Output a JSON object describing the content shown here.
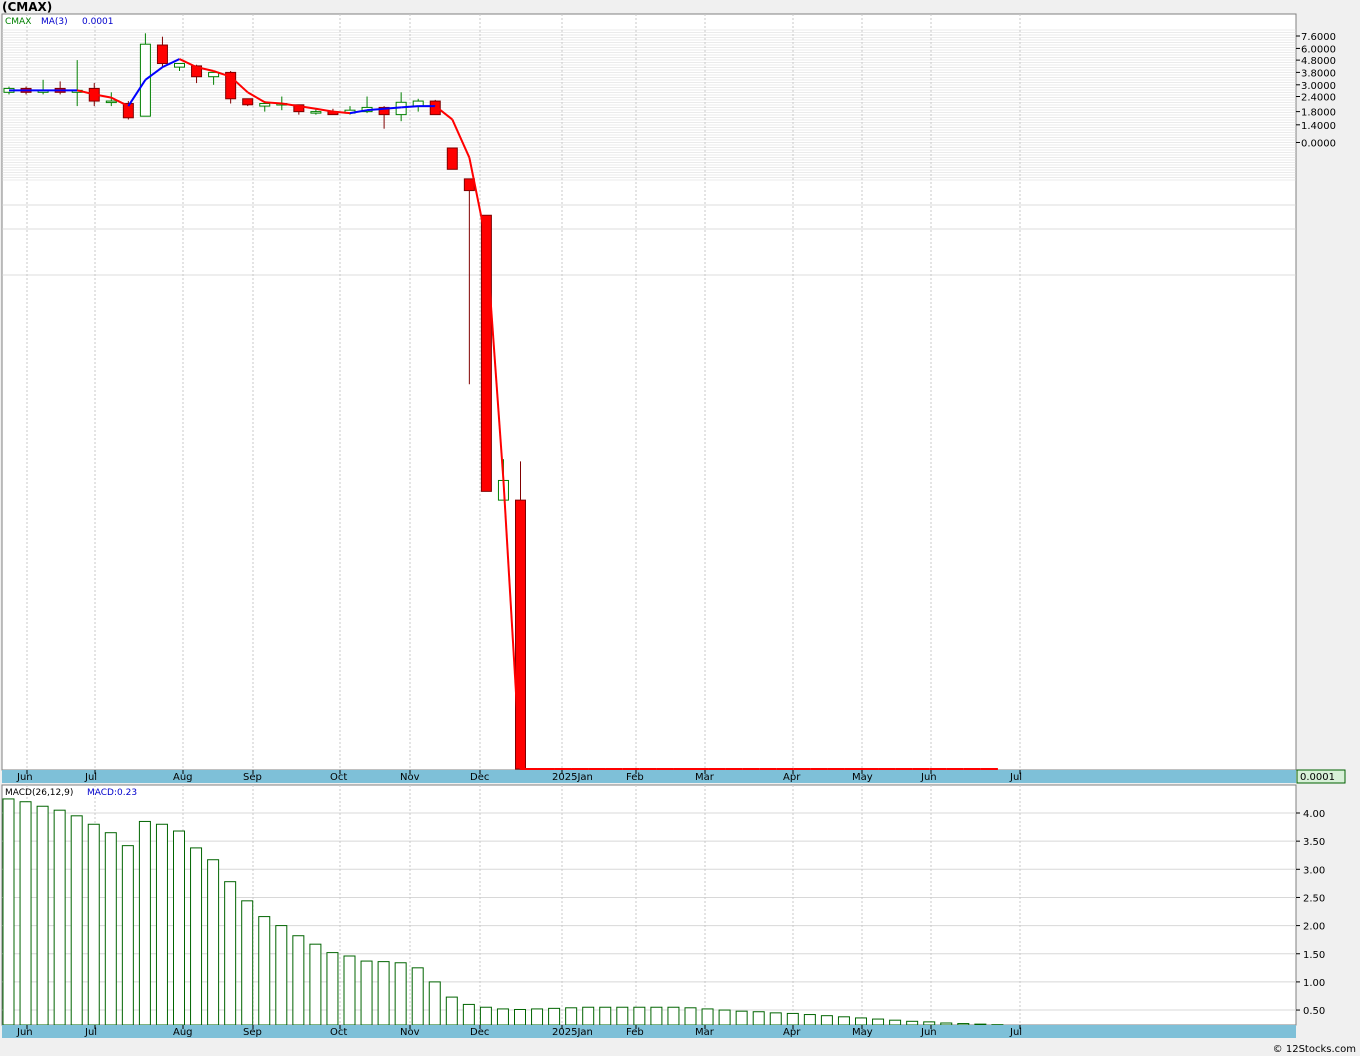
{
  "title": "(CMAX)",
  "price_legend": {
    "symbol": "CMAX",
    "ma_label": "MA(3)",
    "ma_value": "0.0001"
  },
  "macd_legend": {
    "name": "MACD(26,12,9)",
    "value_label": "MACD:0.23"
  },
  "last_price_badge": "0.0001",
  "footer": "© 12Stocks.com",
  "colors": {
    "up": "#008000",
    "down": "#ff0000",
    "ma_up": "#0000ff",
    "ma_down": "#ff0000",
    "axis_strip": "#7ec0d8",
    "macd": "#006400"
  },
  "chart_data": [
    {
      "type": "candlestick",
      "scale": "log",
      "x_tick_labels": [
        "Jun",
        "Jul",
        "Aug",
        "Sep",
        "Oct",
        "Nov",
        "Dec",
        "2025Jan",
        "Feb",
        "Mar",
        "Apr",
        "May",
        "Jun",
        "Jul"
      ],
      "y_tick_labels": [
        "7.6000",
        "6.0000",
        "4.8000",
        "3.8000",
        "3.0000",
        "2.4000",
        "1.8000",
        "1.4000",
        "0.0000"
      ],
      "y_ticks": [
        7.6,
        6.0,
        4.8,
        3.8,
        3.0,
        2.4,
        1.8,
        1.4,
        1.0
      ],
      "candles": [
        {
          "o": 2.6,
          "h": 2.9,
          "l": 2.5,
          "c": 2.8
        },
        {
          "o": 2.8,
          "h": 2.9,
          "l": 2.5,
          "c": 2.6
        },
        {
          "o": 2.6,
          "h": 3.3,
          "l": 2.5,
          "c": 2.7
        },
        {
          "o": 2.8,
          "h": 3.2,
          "l": 2.5,
          "c": 2.6
        },
        {
          "o": 2.6,
          "h": 4.8,
          "l": 2.0,
          "c": 2.7
        },
        {
          "o": 2.8,
          "h": 3.1,
          "l": 2.0,
          "c": 2.2
        },
        {
          "o": 2.2,
          "h": 2.6,
          "l": 2.0,
          "c": 2.2
        },
        {
          "o": 2.1,
          "h": 2.2,
          "l": 1.55,
          "c": 1.6
        },
        {
          "o": 1.65,
          "h": 8.0,
          "l": 1.65,
          "c": 6.5
        },
        {
          "o": 6.4,
          "h": 7.5,
          "l": 4.2,
          "c": 4.5
        },
        {
          "o": 4.2,
          "h": 4.5,
          "l": 3.9,
          "c": 4.5
        },
        {
          "o": 4.3,
          "h": 4.4,
          "l": 3.1,
          "c": 3.5
        },
        {
          "o": 3.5,
          "h": 3.8,
          "l": 3.0,
          "c": 3.8
        },
        {
          "o": 3.8,
          "h": 3.9,
          "l": 2.1,
          "c": 2.3
        },
        {
          "o": 2.3,
          "h": 2.3,
          "l": 2.0,
          "c": 2.05
        },
        {
          "o": 2.0,
          "h": 2.2,
          "l": 1.8,
          "c": 2.1
        },
        {
          "o": 2.1,
          "h": 2.4,
          "l": 1.85,
          "c": 2.1
        },
        {
          "o": 2.05,
          "h": 2.05,
          "l": 1.7,
          "c": 1.8
        },
        {
          "o": 1.75,
          "h": 1.9,
          "l": 1.7,
          "c": 1.8
        },
        {
          "o": 1.8,
          "h": 1.9,
          "l": 1.7,
          "c": 1.7
        },
        {
          "o": 1.75,
          "h": 2.0,
          "l": 1.7,
          "c": 1.85
        },
        {
          "o": 1.8,
          "h": 2.4,
          "l": 1.75,
          "c": 1.95
        },
        {
          "o": 1.95,
          "h": 2.0,
          "l": 1.3,
          "c": 1.7
        },
        {
          "o": 1.7,
          "h": 2.6,
          "l": 1.5,
          "c": 2.15
        },
        {
          "o": 2.0,
          "h": 2.3,
          "l": 1.8,
          "c": 2.2
        },
        {
          "o": 2.2,
          "h": 2.25,
          "l": 1.7,
          "c": 1.7
        },
        {
          "o": 0.9,
          "h": 0.9,
          "l": 0.6,
          "c": 0.6
        },
        {
          "o": 0.5,
          "h": 0.5,
          "l": 0.01,
          "c": 0.4
        },
        {
          "o": 0.25,
          "h": 0.25,
          "l": 0.0013,
          "c": 0.0013
        },
        {
          "o": 0.0011,
          "h": 0.0024,
          "l": 0.0011,
          "c": 0.0016
        },
        {
          "o": 0.0011,
          "h": 0.0023,
          "l": 2.8e-06,
          "c": 2.6e-06
        },
        {
          "o": 2.6e-06,
          "h": 6e-07,
          "l": 9e-09,
          "c": 2e-07
        },
        {
          "o": 2e-07,
          "h": 2e-07,
          "l": 2.5e-09,
          "c": 2e-07
        },
        {
          "o": 5e-08,
          "h": 2e-07,
          "l": 5e-08,
          "c": 1e-08
        },
        {
          "o": 2.2e-09,
          "h": 5e-08,
          "l": 3e-12,
          "c": 2.2e-09
        },
        {
          "o": 2.2e-09,
          "h": 5e-08,
          "l": 1e-14,
          "c": 1e-14
        }
      ],
      "ma_period": 3,
      "ma": [
        2.7,
        2.7,
        2.7,
        2.7,
        2.7,
        2.5,
        2.35,
        2.0,
        3.3,
        4.2,
        4.9,
        4.2,
        3.9,
        3.5,
        2.6,
        2.15,
        2.1,
        2.0,
        1.9,
        1.8,
        1.75,
        1.85,
        1.9,
        1.95,
        2.0,
        2.0,
        1.55,
        0.75,
        0.15,
        0.0016,
        4.2e-06,
        2e-06,
        3e-07,
        2.5e-07,
        3e-08,
        1.5e-10,
        1e-14,
        1e-14,
        1e-14,
        1e-14,
        1e-14,
        1e-14,
        1e-14,
        1e-14,
        1e-14,
        1e-14,
        1e-14,
        1e-14,
        1e-14,
        1e-14,
        1e-14,
        1e-14,
        1e-14,
        1e-14,
        1e-14,
        1e-14,
        1e-14,
        1e-14,
        1e-14
      ]
    },
    {
      "type": "bar",
      "name": "MACD(26,12,9)",
      "y_tick_labels": [
        "4.00",
        "3.50",
        "3.00",
        "2.50",
        "2.00",
        "1.50",
        "1.00",
        "0.50"
      ],
      "ylim": [
        0.25,
        4.3
      ],
      "values": [
        4.25,
        4.2,
        4.12,
        4.05,
        3.95,
        3.8,
        3.65,
        3.42,
        3.85,
        3.8,
        3.68,
        3.38,
        3.17,
        2.78,
        2.44,
        2.16,
        2.0,
        1.82,
        1.67,
        1.52,
        1.46,
        1.37,
        1.36,
        1.34,
        1.25,
        1.0,
        0.73,
        0.6,
        0.55,
        0.52,
        0.51,
        0.52,
        0.53,
        0.54,
        0.55,
        0.55,
        0.55,
        0.55,
        0.55,
        0.55,
        0.54,
        0.52,
        0.5,
        0.48,
        0.47,
        0.45,
        0.44,
        0.42,
        0.4,
        0.38,
        0.36,
        0.34,
        0.32,
        0.3,
        0.29,
        0.27,
        0.26,
        0.25,
        0.24
      ]
    }
  ]
}
